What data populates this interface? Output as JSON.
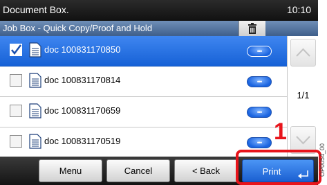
{
  "header": {
    "title": "Document Box.",
    "time": "10:10",
    "subtitle": "Job Box - Quick Copy/Proof and Hold"
  },
  "toolbar": {
    "delete_icon": "trash-icon"
  },
  "documents": [
    {
      "name": "doc 100831170850",
      "checked": true
    },
    {
      "name": "doc 100831170814",
      "checked": false
    },
    {
      "name": "doc 100831170659",
      "checked": false
    },
    {
      "name": "doc 100831170519",
      "checked": false
    }
  ],
  "detail_button_label": "•••",
  "pager": {
    "page": "1/1",
    "up_icon": "chevron-up-icon",
    "down_icon": "chevron-down-icon"
  },
  "buttons": {
    "menu": "Menu",
    "cancel": "Cancel",
    "back": "< Back",
    "print": "Print"
  },
  "annotation": {
    "callout_number": "1",
    "figure_code": "OP0054_00"
  },
  "colors": {
    "selected_row": "#1661d6",
    "accent_red": "#e8141b",
    "titlebar": "#111111",
    "subbar": "#4a6a95"
  }
}
